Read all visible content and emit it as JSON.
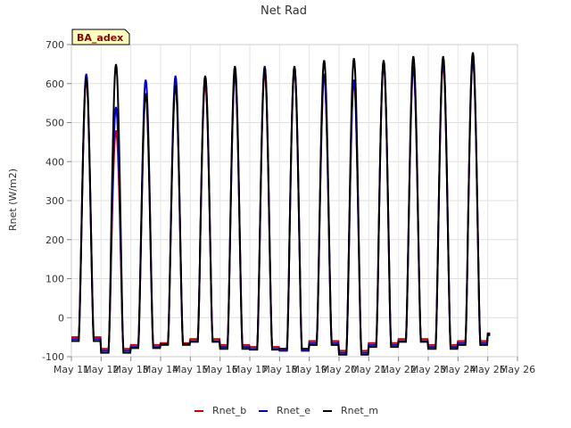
{
  "chart_data": {
    "type": "line",
    "title": "Net Rad",
    "ylabel": "Rnet (W/m2)",
    "xlabel": "",
    "badge": "BA_adex",
    "ylim": [
      -100,
      700
    ],
    "xlim": [
      11,
      26
    ],
    "yticks": [
      -100,
      0,
      100,
      200,
      300,
      400,
      500,
      600,
      700
    ],
    "xticks": [
      {
        "x": 11,
        "label": "May 11"
      },
      {
        "x": 12,
        "label": "May 12"
      },
      {
        "x": 13,
        "label": "May 13"
      },
      {
        "x": 14,
        "label": "May 14"
      },
      {
        "x": 15,
        "label": "May 15"
      },
      {
        "x": 16,
        "label": "May 16"
      },
      {
        "x": 17,
        "label": "May 17"
      },
      {
        "x": 18,
        "label": "May 18"
      },
      {
        "x": 19,
        "label": "May 19"
      },
      {
        "x": 20,
        "label": "May 20"
      },
      {
        "x": 21,
        "label": "May 21"
      },
      {
        "x": 22,
        "label": "May 22"
      },
      {
        "x": 23,
        "label": "May 23"
      },
      {
        "x": 24,
        "label": "May 24"
      },
      {
        "x": 25,
        "label": "May 25"
      },
      {
        "x": 26,
        "label": "May 26"
      }
    ],
    "grid": true,
    "legend_position": "bottom",
    "days": [
      11,
      12,
      13,
      14,
      15,
      16,
      17,
      18,
      19,
      20,
      21,
      22,
      23,
      24,
      25
    ],
    "series": [
      {
        "name": "Rnet_b",
        "color": "#cc0000",
        "peaks": [
          610,
          480,
          575,
          600,
          600,
          620,
          630,
          635,
          620,
          605,
          650,
          640,
          650,
          660,
          40
        ],
        "night": [
          -50,
          -80,
          -70,
          -65,
          -55,
          -70,
          -75,
          -80,
          -60,
          -85,
          -65,
          -55,
          -70,
          -60,
          -40
        ]
      },
      {
        "name": "Rnet_e",
        "color": "#0000cc",
        "peaks": [
          625,
          540,
          610,
          620,
          615,
          625,
          645,
          640,
          625,
          610,
          655,
          645,
          660,
          665,
          40
        ],
        "night": [
          -55,
          -85,
          -75,
          -70,
          -60,
          -75,
          -80,
          -85,
          -65,
          -90,
          -70,
          -60,
          -75,
          -65,
          -45
        ]
      },
      {
        "name": "Rnet_m",
        "color": "#000000",
        "peaks": [
          615,
          650,
          575,
          595,
          620,
          645,
          640,
          645,
          660,
          665,
          660,
          670,
          670,
          680,
          40
        ],
        "night": [
          -60,
          -90,
          -78,
          -68,
          -62,
          -80,
          -82,
          -80,
          -70,
          -95,
          -75,
          -62,
          -80,
          -70,
          -42
        ]
      }
    ]
  }
}
